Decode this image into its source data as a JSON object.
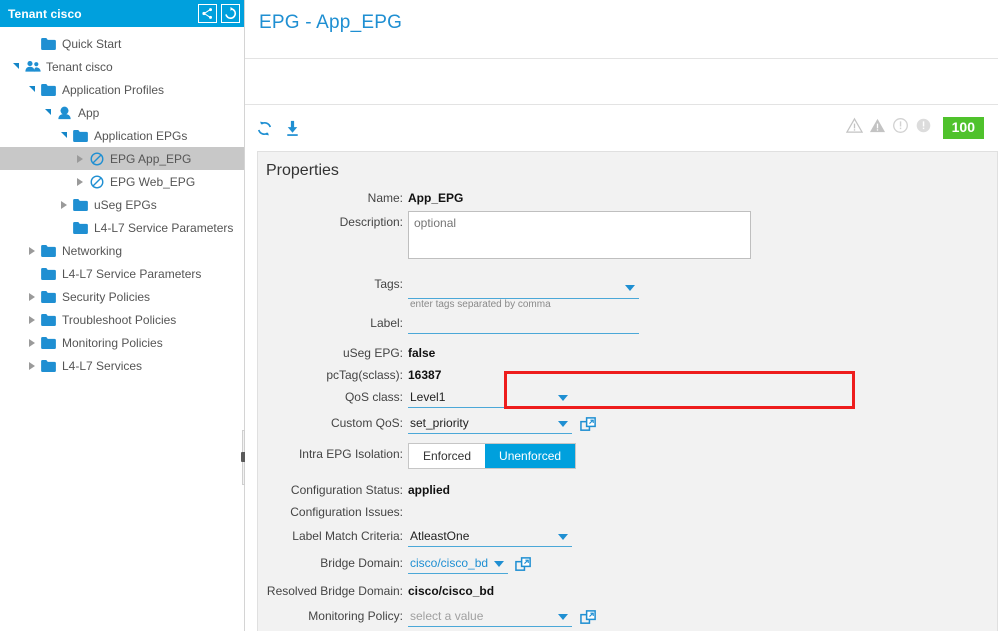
{
  "sidebar": {
    "header": {
      "title": "Tenant cisco",
      "topology_icon": "topology-icon",
      "refresh_icon": "refresh-icon"
    },
    "tree": [
      {
        "label": "Quick Start",
        "indent": 1,
        "icon": "folder",
        "twisty": "none",
        "selected": false
      },
      {
        "label": "Tenant cisco",
        "indent": 0,
        "icon": "users",
        "twisty": "expanded",
        "selected": false
      },
      {
        "label": "Application Profiles",
        "indent": 1,
        "icon": "folder",
        "twisty": "expanded",
        "selected": false
      },
      {
        "label": "App",
        "indent": 2,
        "icon": "app",
        "twisty": "expanded",
        "selected": false
      },
      {
        "label": "Application EPGs",
        "indent": 3,
        "icon": "folder",
        "twisty": "expanded",
        "selected": false
      },
      {
        "label": "EPG App_EPG",
        "indent": 4,
        "icon": "epg",
        "twisty": "collapsed",
        "selected": true
      },
      {
        "label": "EPG Web_EPG",
        "indent": 4,
        "icon": "epg",
        "twisty": "collapsed",
        "selected": false
      },
      {
        "label": "uSeg EPGs",
        "indent": 3,
        "icon": "folder",
        "twisty": "collapsed",
        "selected": false
      },
      {
        "label": "L4-L7 Service Parameters",
        "indent": 3,
        "icon": "folder",
        "twisty": "none",
        "selected": false
      },
      {
        "label": "Networking",
        "indent": 1,
        "icon": "folder",
        "twisty": "collapsed",
        "selected": false
      },
      {
        "label": "L4-L7 Service Parameters",
        "indent": 1,
        "icon": "folder",
        "twisty": "none",
        "selected": false
      },
      {
        "label": "Security Policies",
        "indent": 1,
        "icon": "folder",
        "twisty": "collapsed",
        "selected": false
      },
      {
        "label": "Troubleshoot Policies",
        "indent": 1,
        "icon": "folder",
        "twisty": "collapsed",
        "selected": false
      },
      {
        "label": "Monitoring Policies",
        "indent": 1,
        "icon": "folder",
        "twisty": "collapsed",
        "selected": false
      },
      {
        "label": "L4-L7 Services",
        "indent": 1,
        "icon": "folder",
        "twisty": "collapsed",
        "selected": false
      }
    ]
  },
  "main": {
    "page_title": "EPG - App_EPG",
    "toolbar": {
      "refresh_icon": "refresh-icon",
      "download_icon": "download-icon",
      "fault_icons": [
        "warning-triangle-outline-icon",
        "warning-triangle-filled-icon",
        "info-circle-outline-icon",
        "info-circle-filled-icon"
      ],
      "health_score": "100",
      "health_color": "#4fc22c"
    },
    "properties": {
      "title": "Properties",
      "name": {
        "label": "Name:",
        "value": "App_EPG"
      },
      "description": {
        "label": "Description:",
        "placeholder": "optional",
        "value": ""
      },
      "tags": {
        "label": "Tags:",
        "value": "",
        "helper": "enter tags separated by comma"
      },
      "label_field": {
        "label": "Label:",
        "value": ""
      },
      "useg_epg": {
        "label": "uSeg EPG:",
        "value": "false"
      },
      "pctag": {
        "label": "pcTag(sclass):",
        "value": "16387"
      },
      "qos_class": {
        "label": "QoS class:",
        "value": "Level1"
      },
      "custom_qos": {
        "label": "Custom QoS:",
        "value": "set_priority",
        "link_icon": "open-in-new-window-icon"
      },
      "intra_epg_isolation": {
        "label": "Intra EPG Isolation:",
        "options": [
          "Enforced",
          "Unenforced"
        ],
        "selected": "Unenforced"
      },
      "configuration_status": {
        "label": "Configuration Status:",
        "value": "applied"
      },
      "configuration_issues": {
        "label": "Configuration Issues:",
        "value": ""
      },
      "label_match_criteria": {
        "label": "Label Match Criteria:",
        "value": "AtleastOne"
      },
      "bridge_domain": {
        "label": "Bridge Domain:",
        "value": "cisco/cisco_bd",
        "link_icon": "open-in-new-window-icon"
      },
      "resolved_bridge_domain": {
        "label": "Resolved Bridge Domain:",
        "value": "cisco/cisco_bd"
      },
      "monitoring_policy": {
        "label": "Monitoring Policy:",
        "placeholder": "select a value",
        "value": "",
        "link_icon": "open-in-new-window-icon"
      }
    },
    "highlight": {
      "color": "#ee1d1d",
      "target": "custom-qos-row"
    }
  }
}
